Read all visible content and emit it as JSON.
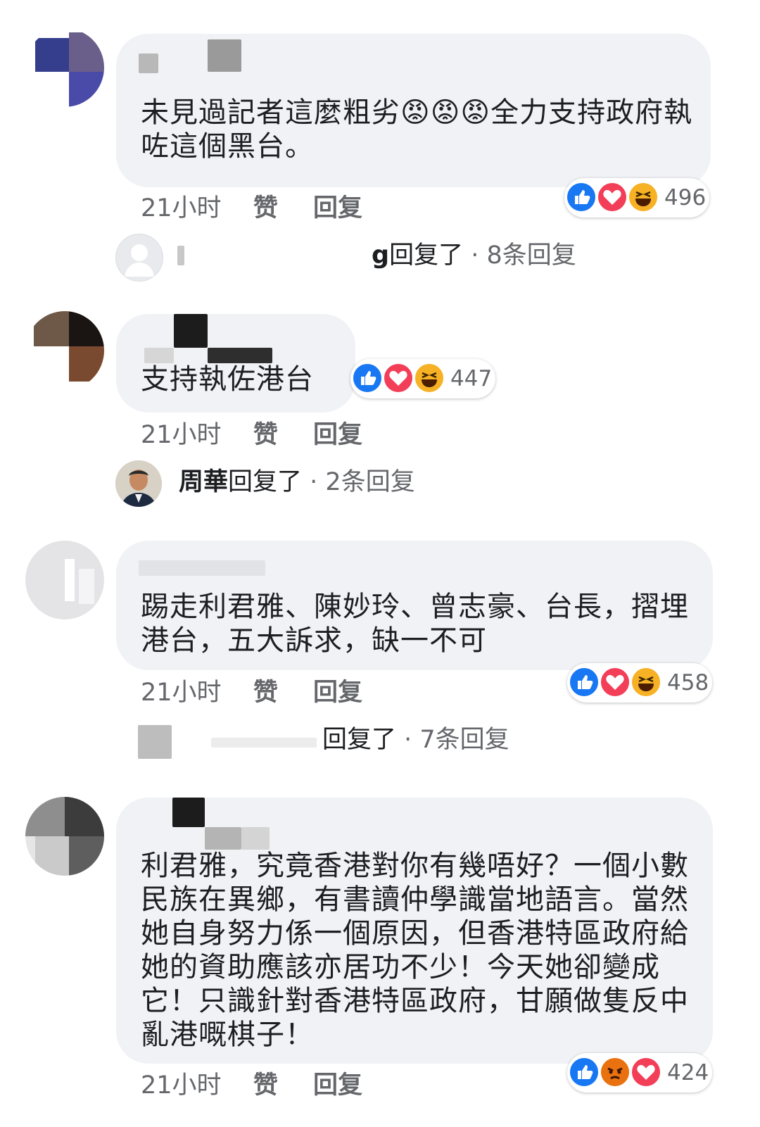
{
  "comments": [
    {
      "text": "未見過記者這麼粗劣😡😡😡全力支持政府執咗這個黑台。",
      "time": "21小时",
      "like": "赞",
      "reply": "回复",
      "reaction_count": "496",
      "reactions": [
        "like-icon",
        "love-icon",
        "haha-icon"
      ],
      "replies_summary": {
        "name_fragment": "g",
        "action": "回复了",
        "sep": " · ",
        "count": "8条回复"
      }
    },
    {
      "text": "支持執佐港台",
      "time": "21小时",
      "like": "赞",
      "reply": "回复",
      "reaction_count": "447",
      "reactions": [
        "like-icon",
        "love-icon",
        "haha-icon"
      ],
      "replies_summary": {
        "name": "周華",
        "action": "回复了",
        "sep": " · ",
        "count": "2条回复"
      }
    },
    {
      "text": "踢走利君雅、陳妙玲、曾志豪、台長，摺埋港台，五大訴求，缺一不可",
      "time": "21小时",
      "like": "赞",
      "reply": "回复",
      "reaction_count": "458",
      "reactions": [
        "like-icon",
        "love-icon",
        "haha-icon"
      ],
      "replies_summary": {
        "action": "回复了",
        "sep": " · ",
        "count": "7条回复"
      }
    },
    {
      "text": "利君雅，究竟香港對你有幾唔好？一個小數民族在異鄉，有書讀仲學識當地語言。當然她自身努力係一個原因，但香港特區政府給她的資助應該亦居功不少！今天她卻變成它！只識針對香港特區政府，甘願做隻反中亂港嘅棋子！",
      "time": "21小时",
      "like": "赞",
      "reply": "回复",
      "reaction_count": "424",
      "reactions": [
        "like-icon",
        "angry-icon",
        "love-icon"
      ]
    }
  ],
  "colors": {
    "bubble": "#f0f2f5",
    "meta_text": "#65676b",
    "like_blue": "#1877f2",
    "love_red": "#f33e58",
    "haha_yellow": "#f7b125",
    "angry_orange": "#e9710f"
  }
}
